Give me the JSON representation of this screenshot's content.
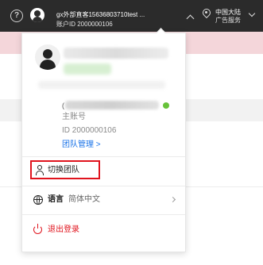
{
  "topbar": {
    "help_icon": "help-circle-icon",
    "account_name": "gx外部直客15636803710test ...",
    "account_id_line": "账户ID 2000000106",
    "region_line1": "中国大陆",
    "region_line2": "广告服务"
  },
  "panel": {
    "account_prefix": "(",
    "account_type": "主账号",
    "account_id": "ID 2000000106",
    "team_manage": "团队管理 >",
    "switch_team": "切换团队",
    "language_label": "语言",
    "language_value": "简体中文",
    "logout": "退出登录"
  },
  "colors": {
    "topbar_bg": "#2b2b2b",
    "link_blue": "#1a73e8",
    "danger_red": "#e0141e",
    "verified_green": "#67c23a"
  }
}
